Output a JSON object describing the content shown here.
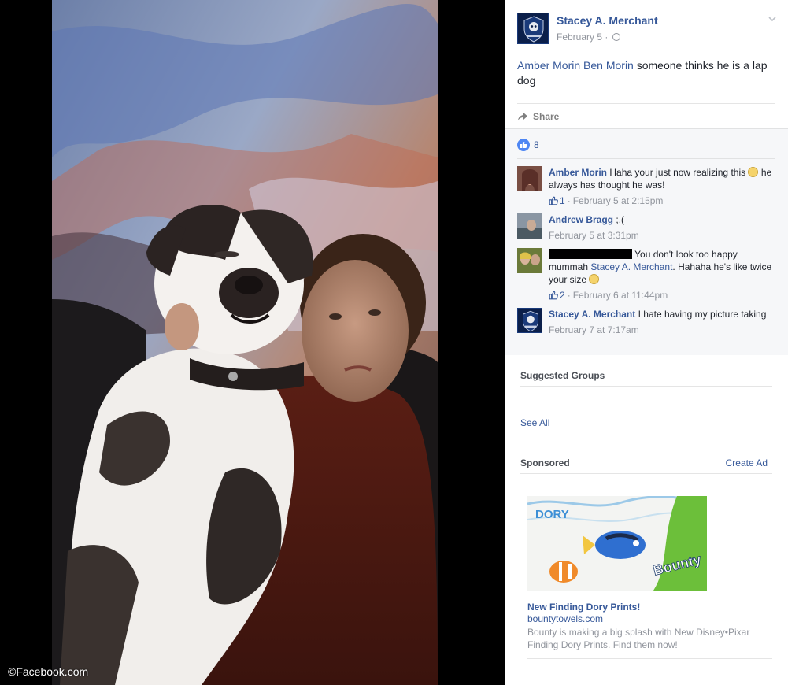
{
  "watermark": "©Facebook.com",
  "post": {
    "author": "Stacey A. Merchant",
    "date": "February 5",
    "date_sep": "·",
    "tagged_1": "Amber Morin",
    "tagged_2": "Ben Morin",
    "text": "someone thinks he is a lap dog",
    "share_label": "Share",
    "like_count": "8"
  },
  "comments": [
    {
      "name": "Amber Morin",
      "text": "Haha your just now realizing this",
      "text_2": "he always has thought he was!",
      "likes": "1",
      "sep": "·",
      "time": "February 5 at 2:15pm"
    },
    {
      "name": "Andrew Bragg",
      "text": ";.(",
      "time": "February 5 at 3:31pm"
    },
    {
      "text_a": "You don't look too happy mummah",
      "mention": "Stacey A. Merchant",
      "text_b": ". Hahaha he's like twice your size",
      "likes": "2",
      "sep": "·",
      "time": "February 6 at 11:44pm"
    },
    {
      "name": "Stacey A. Merchant",
      "text": "I hate having my picture taking",
      "time": "February 7 at 7:17am"
    }
  ],
  "suggested_groups": {
    "title": "Suggested Groups",
    "see_all": "See All"
  },
  "sponsored": {
    "title": "Sponsored",
    "create_ad": "Create Ad",
    "ad": {
      "image_label_1": "DORY",
      "image_label_2": "Bounty",
      "title": "New Finding Dory Prints!",
      "domain": "bountytowels.com",
      "description": "Bounty is making a big splash with New Disney•Pixar Finding Dory Prints. Find them now!"
    }
  },
  "colors": {
    "link": "#365899",
    "meta": "#90949c",
    "panel_bg": "#f6f7f9",
    "like_blue": "#4e86f3"
  },
  "icons": [
    "thumbs-up-icon",
    "share-arrow-icon",
    "globe-icon",
    "chevron-down-icon"
  ]
}
